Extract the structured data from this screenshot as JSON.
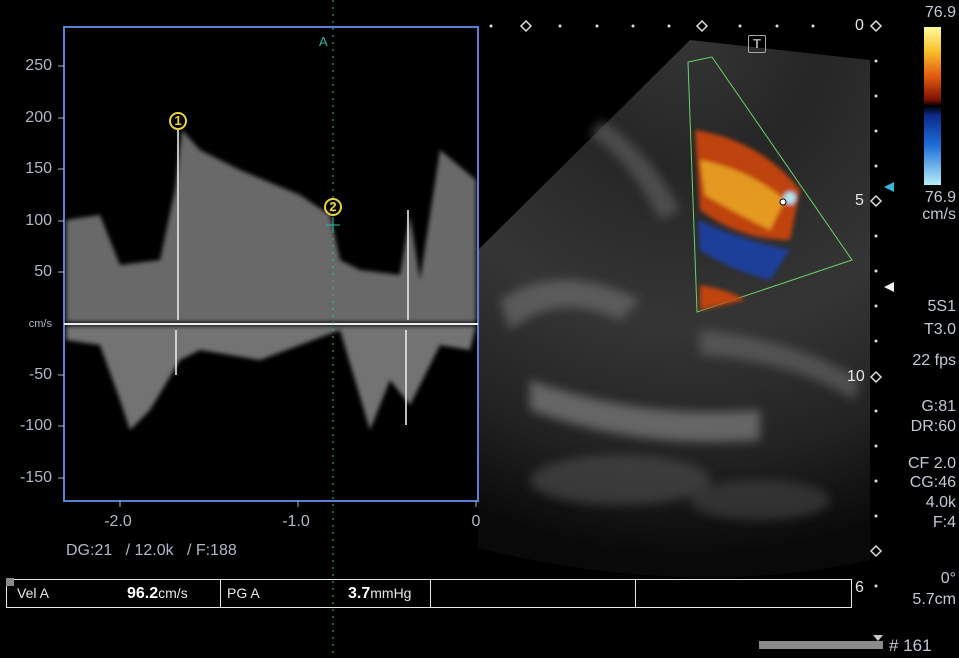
{
  "spectral": {
    "y_ticks": [
      "250",
      "200",
      "150",
      "100",
      "50",
      "cm/s",
      "-50",
      "-100",
      "-150"
    ],
    "x_ticks": [
      "-2.0",
      "-1.0",
      "0"
    ],
    "cursor_label": "A",
    "settings_line": "DG:21   / 12.0k   / F:188",
    "markers": [
      "1",
      "2"
    ]
  },
  "measurements": {
    "vel_label": "Vel A",
    "vel_value": "96.2",
    "vel_unit": "cm/s",
    "pg_label": "PG A",
    "pg_value": "3.7",
    "pg_unit": "mmHg"
  },
  "color_scale": {
    "max": "76.9",
    "min": "76.9",
    "unit": "cm/s",
    "colors": [
      "#fdfca0",
      "#f6c22a",
      "#e0560e",
      "#7a1205",
      "#000000",
      "#0a2a8a",
      "#1f6ed8",
      "#b6f0fb"
    ]
  },
  "depth_scale": [
    "0",
    "5",
    "10",
    "6"
  ],
  "image_settings": {
    "probe": "5S1",
    "transducer": "T3.0",
    "fps": "22 fps",
    "gain": "G:81",
    "dynamic_range": "DR:60",
    "cf": "CF 2.0",
    "cg": "CG:46",
    "prf": "4.0k",
    "filter": "F:4",
    "angle": "0°",
    "depth": "5.7cm"
  },
  "frame_counter": "# 161",
  "icons": [
    "t-mark-icon",
    "color-bar-arrow-icon",
    "focus-arrow-icon",
    "frame-scroll-icon"
  ]
}
